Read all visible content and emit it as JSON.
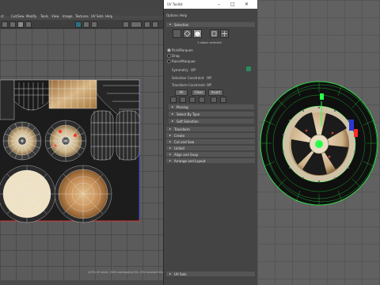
{
  "uv_editor": {
    "menus": [
      "ct",
      "Cut/Sew",
      "Modify",
      "Tools",
      "View",
      "Image",
      "Textures",
      "UV Sets",
      "Help"
    ],
    "status_text": "(0/70) UV shells, 200% overlapping UVs, 20% reversed UVs"
  },
  "uv_toolkit": {
    "title": "UV Toolkit",
    "menus": [
      "Options",
      "Help"
    ],
    "selection": {
      "header": "Selection",
      "selected_count": "1 object selected",
      "modes": [
        "Pick/Marquee",
        "Drag",
        "Raise/Marquee"
      ],
      "active_mode_index": 0,
      "symmetry_label": "Symmetry",
      "symmetry_value": "Off",
      "selection_constraint_label": "Selection Constraint",
      "selection_constraint_value": "Off",
      "transform_constraint_label": "Transform Constraint",
      "transform_constraint_value": "Off",
      "buttons": [
        "All",
        "Clear",
        "Invert"
      ]
    },
    "subsections": [
      "Pinning",
      "Select By Type",
      "Soft Selection"
    ],
    "sections": [
      "Transform",
      "Create",
      "Cut and Sew",
      "Unfold",
      "Align and Snap",
      "Arrange and Layout"
    ],
    "footer_section": "UV Sets"
  },
  "colors": {
    "uv_blue": "#2a36d8",
    "uv_red": "#ff2a2a",
    "mesh_green": "#2aff4a",
    "tire": "#0d0d0d"
  }
}
